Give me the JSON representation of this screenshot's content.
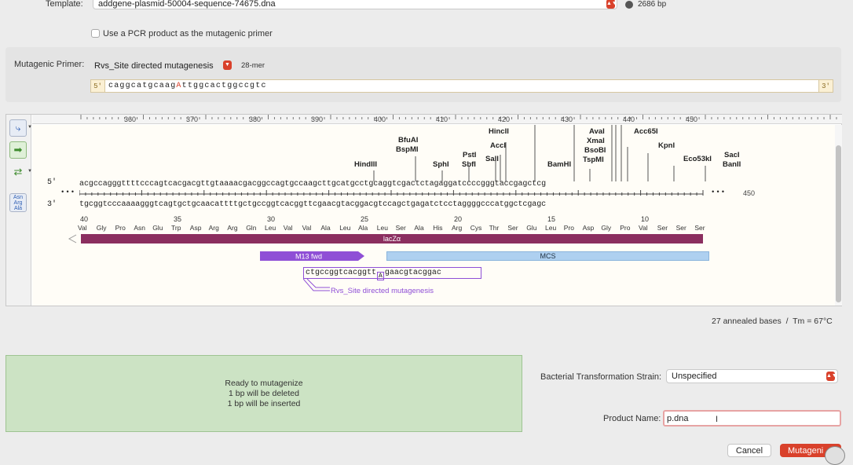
{
  "template": {
    "label": "Template:",
    "file": "addgene-plasmid-50004-sequence-74675.dna",
    "length": "2686 bp"
  },
  "pcr_checkbox": {
    "label": "Use a PCR product as the mutagenic primer",
    "checked": false
  },
  "primer": {
    "label": "Mutagenic Primer:",
    "selected": "Rvs_Site directed mutagenesis",
    "length": "28-mer",
    "end5": "5′",
    "end3": "3′",
    "seq_before": "caggcatgcaag",
    "seq_mut": "A",
    "seq_after": "ttggcactggccgtc"
  },
  "map": {
    "ruler_ticks": [
      "360",
      "370",
      "380",
      "390",
      "400",
      "410",
      "420",
      "430",
      "440",
      "450"
    ],
    "strand5_label": "5′",
    "strand3_label": "3′",
    "top_strand": "acgccagggttttcccagtcacgacgttgtaaaacgacggccagtgccaagcttgcatgcctgcaggtcgactctagaggatccccgggtaccgagctcg",
    "bottom_strand": "tgcggtcccaaaagggtcagtgctgcaacattttgctgccggtcacggttcgaacgtacggacgtccagctgagatctcctaggggcccatggctcgagc",
    "dots_left": "•••",
    "dots_right": "•••",
    "end_position": "450",
    "enzymes": {
      "hindiii": "HindIII",
      "bfuai": "BfuAI",
      "bspmi": "BspMI",
      "sphi": "SphI",
      "psti": "PstI",
      "sbfi": "SbfI",
      "sali": "SalI",
      "acci": "AccI",
      "hincii": "HincII",
      "bamhi": "BamHI",
      "avai": "AvaI",
      "xmai": "XmaI",
      "bsobi": "BsoBI",
      "tspmi": "TspMI",
      "acc65i": "Acc65I",
      "kpni": "KpnI",
      "eco53ki": "Eco53kI",
      "saci": "SacI",
      "banii": "BanII"
    },
    "aa_numbers": [
      "40",
      "35",
      "30",
      "25",
      "20",
      "15",
      "10"
    ],
    "amino_acids": [
      "Val",
      "Gly",
      "Pro",
      "Asn",
      "Glu",
      "Trp",
      "Asp",
      "Arg",
      "Arg",
      "Gln",
      "Leu",
      "Val",
      "Val",
      "Ala",
      "Leu",
      "Ala",
      "Leu",
      "Ser",
      "Ala",
      "His",
      "Arg",
      "Cys",
      "Thr",
      "Ser",
      "Glu",
      "Leu",
      "Pro",
      "Asp",
      "Gly",
      "Pro",
      "Val",
      "Ser",
      "Ser",
      "Ser"
    ],
    "features": {
      "lacz": "lacZα",
      "m13": "M13 fwd",
      "mcs": "MCS"
    },
    "primer_bases_left": "ctgccggtcacggtt",
    "primer_bases_right": "gaacgtacggac",
    "primer_mismatch": "A",
    "primer_name": "Rvs_Site directed mutagenesis"
  },
  "annealed": "27 annealed bases  /  Tm = 67°C",
  "status": {
    "line1": "Ready to mutagenize",
    "line2": "1 bp will be deleted",
    "line3": "1 bp will be inserted"
  },
  "strain": {
    "label": "Bacterial Transformation Strain:",
    "selected": "Unspecified"
  },
  "product": {
    "label": "Product Name:",
    "value": "p.dna"
  },
  "buttons": {
    "cancel": "Cancel",
    "mutagenize": "Mutageni"
  },
  "colors": {
    "accent": "#d9412b",
    "lacz": "#8b2e5f",
    "m13": "#8f4fd6",
    "mcs": "#aed0f0",
    "primer": "#8f4fd6",
    "status_bg": "#cce3c4"
  }
}
